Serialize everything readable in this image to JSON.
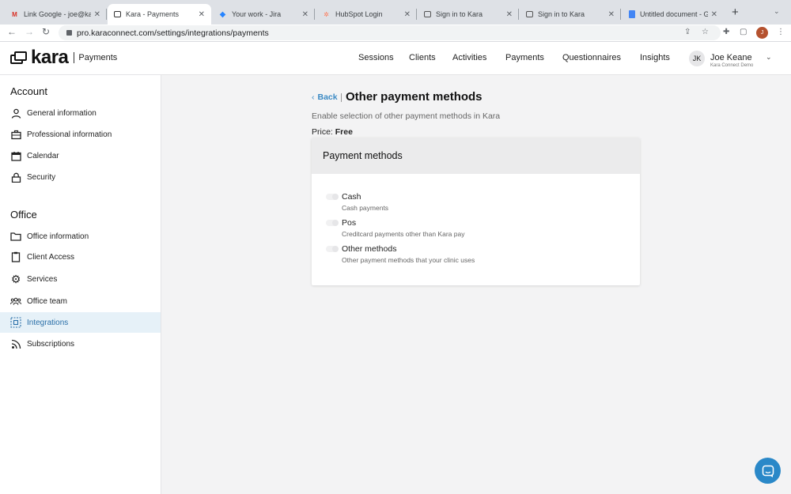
{
  "browser": {
    "tabs": [
      {
        "title": "Link Google - joe@kar",
        "icon": "gmail-icon"
      },
      {
        "title": "Kara - Payments",
        "icon": "kara-icon"
      },
      {
        "title": "Your work - Jira",
        "icon": "jira-icon"
      },
      {
        "title": "HubSpot Login",
        "icon": "hubspot-icon"
      },
      {
        "title": "Sign in to Kara",
        "icon": "kara-icon"
      },
      {
        "title": "Sign in to Kara",
        "icon": "kara-icon"
      },
      {
        "title": "Untitled document - G",
        "icon": "docs-icon"
      }
    ],
    "url": "pro.karaconnect.com/settings/integrations/payments",
    "profile_initial": "J"
  },
  "app": {
    "logo": "kara",
    "section": "Payments",
    "nav": [
      "Sessions",
      "Clients",
      "Activities",
      "Payments",
      "Questionnaires",
      "Insights"
    ],
    "user": {
      "initials": "JK",
      "name": "Joe Keane",
      "org": "Kara Connect Demo"
    }
  },
  "sidebar": {
    "account_title": "Account",
    "account_items": [
      {
        "label": "General information",
        "icon": "user-icon"
      },
      {
        "label": "Professional information",
        "icon": "briefcase-icon"
      },
      {
        "label": "Calendar",
        "icon": "calendar-icon"
      },
      {
        "label": "Security",
        "icon": "lock-icon"
      }
    ],
    "office_title": "Office",
    "office_items": [
      {
        "label": "Office information",
        "icon": "folder-icon"
      },
      {
        "label": "Client Access",
        "icon": "clipboard-icon"
      },
      {
        "label": "Services",
        "icon": "gear-icon"
      },
      {
        "label": "Office team",
        "icon": "team-icon"
      },
      {
        "label": "Integrations",
        "icon": "integrations-icon",
        "active": true
      },
      {
        "label": "Subscriptions",
        "icon": "rss-icon"
      }
    ]
  },
  "main": {
    "back_label": "Back",
    "title": "Other payment methods",
    "subtitle": "Enable selection of other payment methods in Kara",
    "price_label": "Price:",
    "price_value": "Free",
    "card_title": "Payment methods",
    "methods": [
      {
        "label": "Cash",
        "description": "Cash payments",
        "enabled": false
      },
      {
        "label": "Pos",
        "description": "Creditcard payments other than Kara pay",
        "enabled": false
      },
      {
        "label": "Other methods",
        "description": "Other payment methods that your clinic uses",
        "enabled": false
      }
    ]
  },
  "colors": {
    "accent": "#3b8ac4",
    "active_bg": "#e6f1f8",
    "chat": "#2a88c8"
  }
}
